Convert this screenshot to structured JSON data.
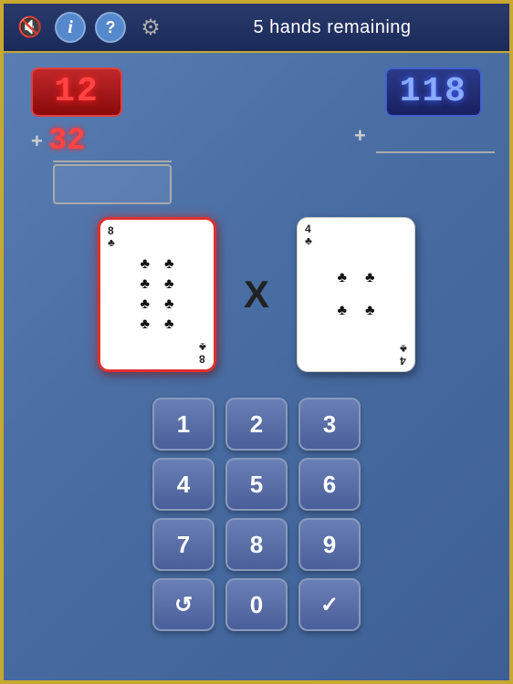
{
  "topBar": {
    "handsRemaining": "5  hands remaining",
    "icons": {
      "speaker": "🔇",
      "info": "i",
      "question": "?",
      "gear": "⚙"
    }
  },
  "scores": {
    "left": {
      "value": "12",
      "running": "32",
      "color": "red"
    },
    "right": {
      "value": "118",
      "color": "blue"
    }
  },
  "cards": {
    "left": {
      "rank": "8",
      "suit": "♣",
      "pips": 8,
      "highlighted": true
    },
    "right": {
      "rank": "4",
      "suit": "♣",
      "pips": 4,
      "highlighted": false
    },
    "operator": "X"
  },
  "keypad": {
    "rows": [
      [
        "1",
        "2",
        "3"
      ],
      [
        "4",
        "5",
        "6"
      ],
      [
        "7",
        "8",
        "9"
      ],
      [
        "↺",
        "0",
        "✓"
      ]
    ]
  }
}
